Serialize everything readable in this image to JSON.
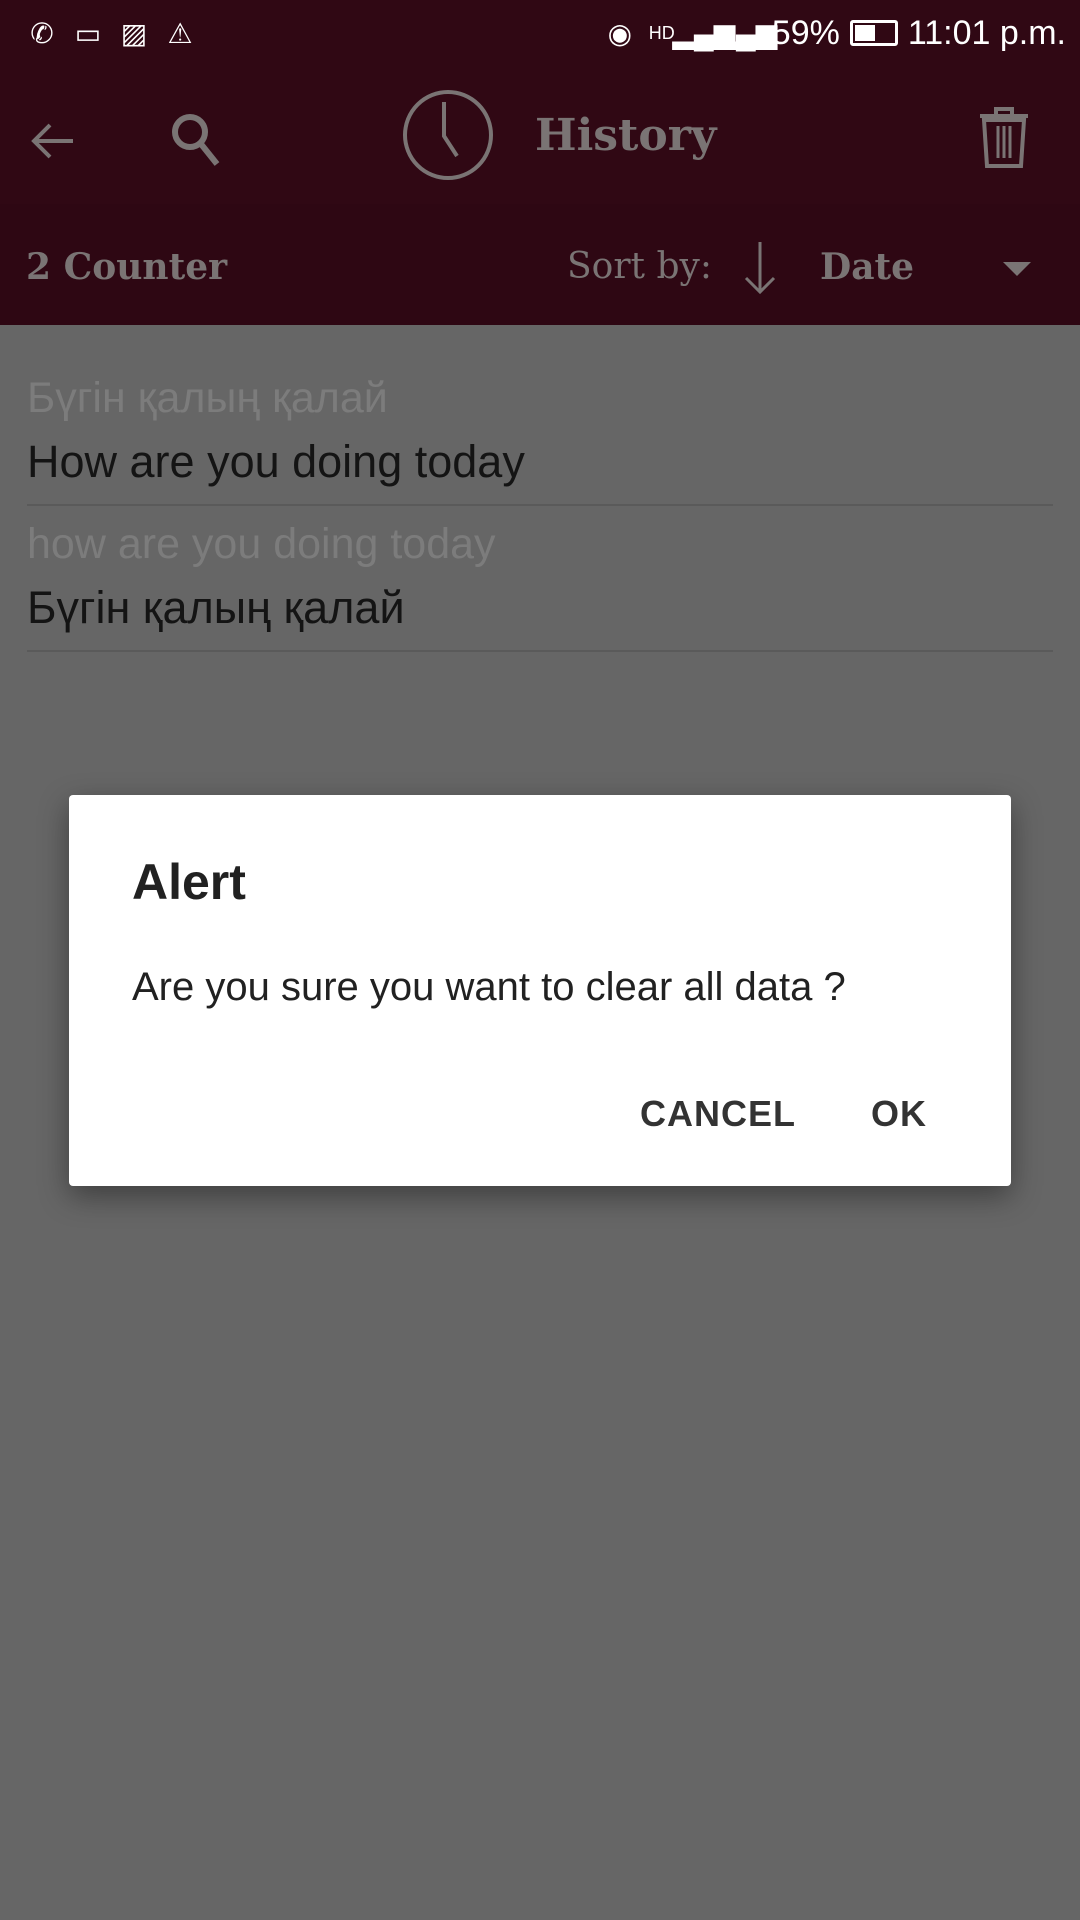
{
  "status_bar": {
    "battery": "59%",
    "time": "11:01 p.m.",
    "left_icons": [
      "whatsapp-icon",
      "message-icon",
      "image-icon",
      "warning-icon"
    ],
    "right_icons": [
      "hotspot-icon",
      "hd-call-icon",
      "signal-1-icon",
      "signal-2-icon",
      "battery-icon"
    ]
  },
  "toolbar": {
    "title": "History",
    "icons": [
      "back-arrow-icon",
      "search-icon",
      "clock-icon",
      "trash-icon"
    ]
  },
  "sort_bar": {
    "counter": "2 Counter",
    "sort_label": "Sort by:",
    "sort_value": "Date"
  },
  "history": [
    {
      "source": "Бүгін қалың қалай",
      "translation": "How are you doing today"
    },
    {
      "source": "how are you doing today",
      "translation": "Бүгін қалың қалай"
    }
  ],
  "dialog": {
    "title": "Alert",
    "message": "Are you sure you want to clear all data ?",
    "cancel": "CANCEL",
    "ok": "OK"
  },
  "colors": {
    "header": "#300814",
    "overlay": "#666666",
    "dialog": "#ffffff"
  }
}
